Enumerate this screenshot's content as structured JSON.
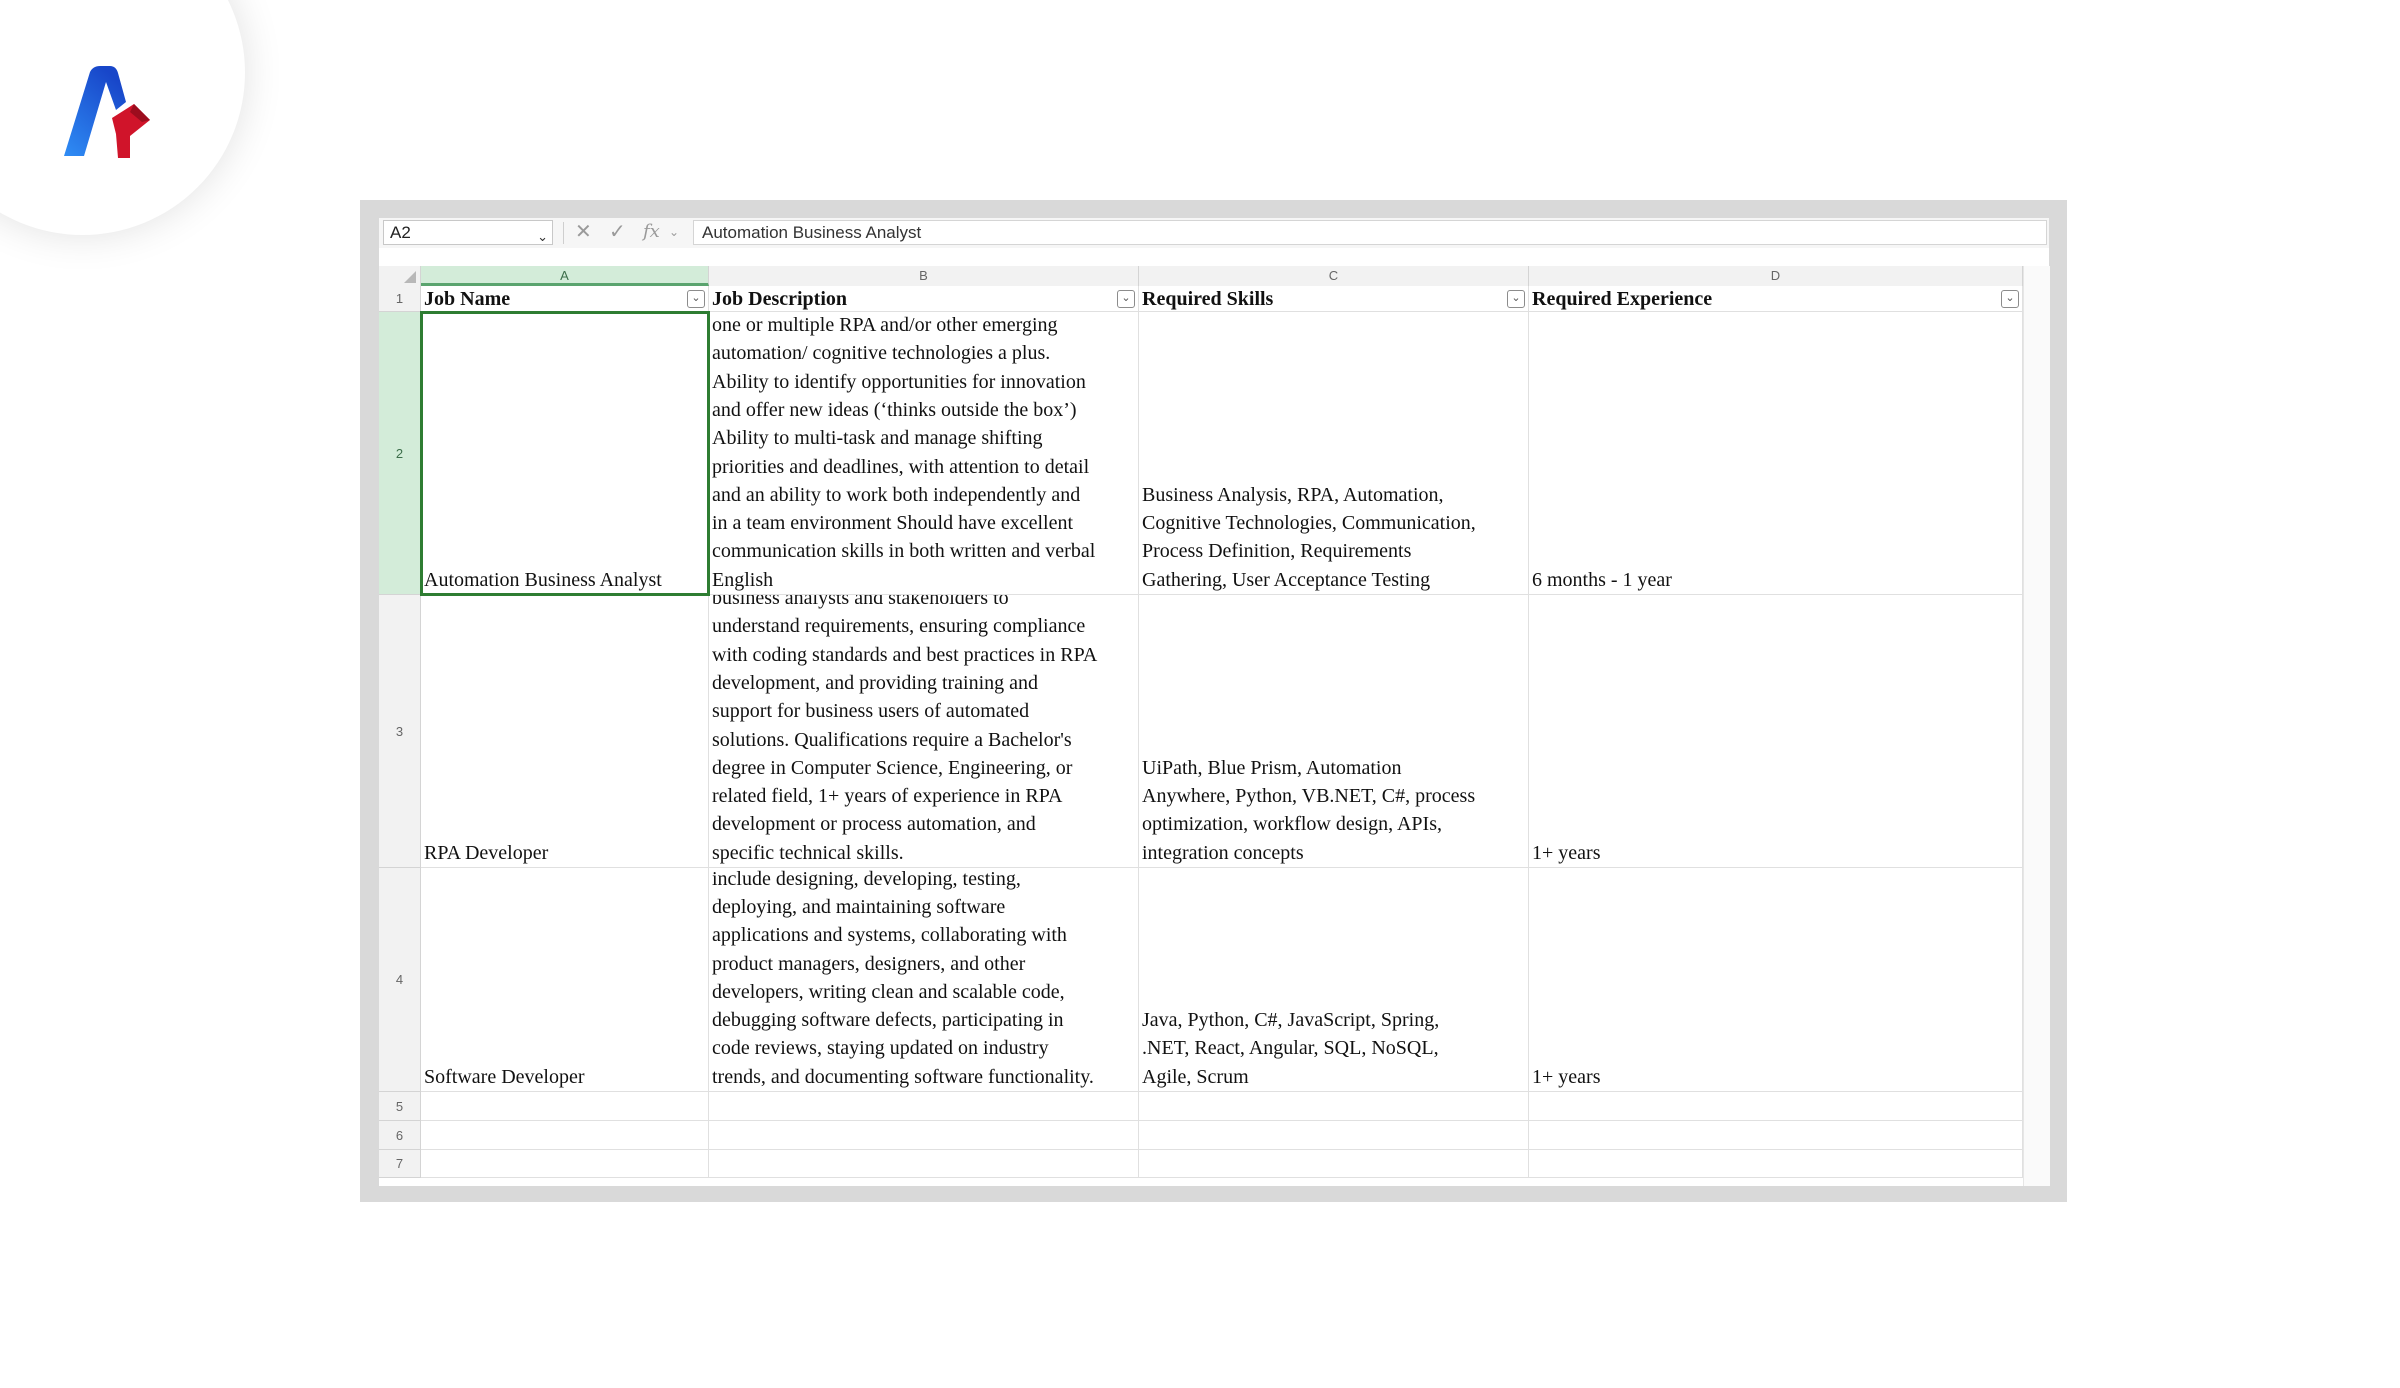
{
  "formula_bar": {
    "cell_ref": "A2",
    "cancel_icon": "close-icon",
    "enter_icon": "check-icon",
    "function_icon": "fx-icon",
    "fx_label": "fx",
    "content": "Automation Business Analyst"
  },
  "columns": [
    "A",
    "B",
    "C",
    "D"
  ],
  "rows": [
    "1",
    "2",
    "3",
    "4",
    "5",
    "6",
    "7"
  ],
  "header": {
    "job_name": "Job Name",
    "job_description": "Job Description",
    "required_skills": "Required Skills",
    "required_experience": "Required Experience"
  },
  "records": [
    {
      "job_name": "Automation Business Analyst",
      "job_description": "one or multiple RPA and/or other emerging\nautomation/ cognitive technologies a plus.\nAbility to identify opportunities for innovation\nand offer new ideas (‘thinks outside the box’)\nAbility to multi-task and manage shifting\npriorities and deadlines, with attention to detail\nand an ability to work both independently and\nin a team environment Should have excellent\ncommunication skills in both written and verbal\nEnglish",
      "required_skills": "Business Analysis, RPA, Automation,\nCognitive Technologies, Communication,\nProcess Definition, Requirements\nGathering, User Acceptance Testing",
      "required_experience": "6 months - 1 year"
    },
    {
      "job_name": "RPA Developer",
      "job_description": "business analysts and stakeholders to\nunderstand requirements, ensuring compliance\nwith coding standards and best practices in RPA\ndevelopment, and providing training and\nsupport for business users of automated\nsolutions. Qualifications require a Bachelor's\ndegree in Computer Science, Engineering, or\nrelated field, 1+ years of experience in RPA\ndevelopment or process automation, and\nspecific technical skills.",
      "required_skills": "UiPath, Blue Prism, Automation\nAnywhere, Python, VB.NET, C#, process\noptimization, workflow design, APIs,\nintegration concepts",
      "required_experience": "1+ years"
    },
    {
      "job_name": "Software Developer",
      "job_description": "include designing, developing, testing,\ndeploying, and maintaining software\napplications and systems, collaborating with\nproduct managers, designers, and other\ndevelopers, writing clean and scalable code,\ndebugging software defects, participating in\ncode reviews, staying updated on industry\ntrends, and documenting software functionality.",
      "required_skills": "Java, Python, C#, JavaScript, Spring,\n.NET, React, Angular, SQL, NoSQL,\nAgile, Scrum",
      "required_experience": "1+ years"
    }
  ],
  "colors": {
    "selection_green": "#2e7d32",
    "header_highlight": "#d3ecd9",
    "frame_gray": "#d9d9d9",
    "logo_blue": "#1e6fe8",
    "logo_red": "#d0142a"
  }
}
